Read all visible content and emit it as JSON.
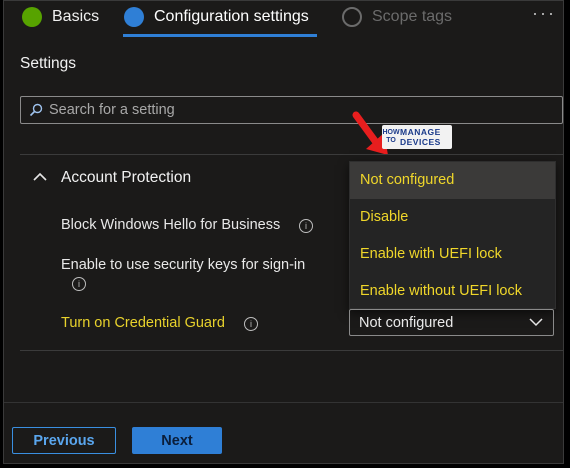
{
  "tabs": [
    {
      "label": "Basics",
      "state": "complete"
    },
    {
      "label": "Configuration settings",
      "state": "active"
    },
    {
      "label": "Scope tags",
      "state": "upcoming"
    }
  ],
  "more_icon": "more-dots-icon",
  "section_title": "Settings",
  "search": {
    "placeholder": "Search for a setting",
    "icon": "search-icon"
  },
  "watermark": {
    "how_to": "HOW TO",
    "manage": "MANAGE",
    "devices": "DEVICES"
  },
  "category": {
    "title": "Account Protection",
    "expanded": true
  },
  "settings": [
    {
      "label": "Block Windows Hello for Business"
    },
    {
      "label": "Enable to use security keys for sign-in"
    },
    {
      "label": "Turn on Credential Guard",
      "value": "Not configured"
    }
  ],
  "dropdown": {
    "options": [
      "Not configured",
      "Disable",
      "Enable with UEFI lock",
      "Enable without UEFI lock"
    ],
    "selected": "Not configured"
  },
  "footer": {
    "previous": "Previous",
    "next": "Next"
  },
  "colors": {
    "accent": "#2f7fd6",
    "highlight": "#f0d72a",
    "complete": "#57a300",
    "annotation": "#e81e1e"
  }
}
